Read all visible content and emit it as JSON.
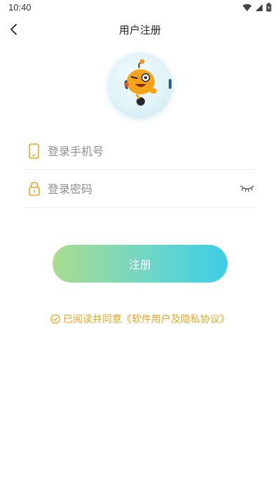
{
  "status": {
    "time": "10:40"
  },
  "header": {
    "title": "用户注册"
  },
  "form": {
    "phone_placeholder": "登录手机号",
    "password_placeholder": "登录密码"
  },
  "register_button": {
    "label": "注册"
  },
  "agreement": {
    "prefix": "已阅读并同意",
    "link": "《软件用户及隐私协议》"
  },
  "colors": {
    "accent_orange": "#f2a41e",
    "button_gradient_start": "#abdc8f",
    "button_gradient_end": "#3dcde6"
  },
  "icons": [
    "wifi-icon",
    "signal-icon",
    "battery-icon",
    "back-arrow-icon",
    "mascot-avatar",
    "phone-icon",
    "lock-icon",
    "eye-closed-icon",
    "check-circle-icon"
  ]
}
